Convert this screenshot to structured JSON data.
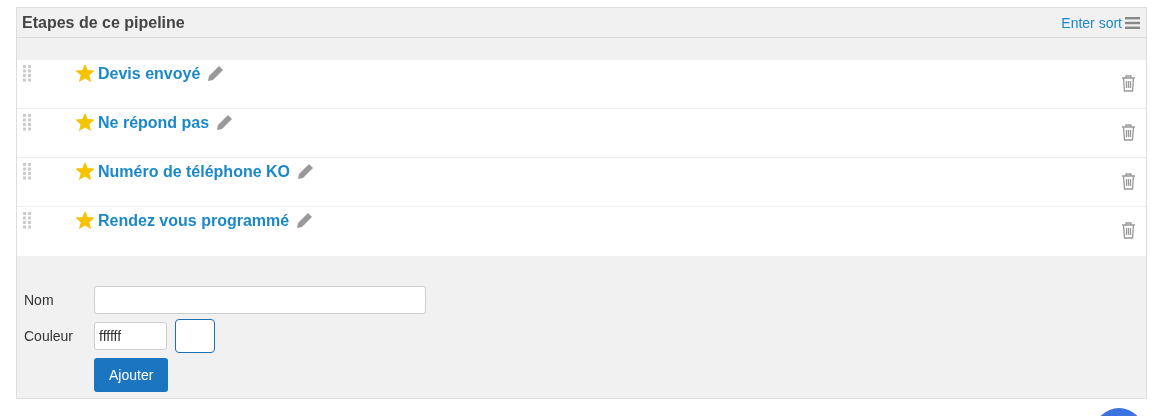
{
  "panel": {
    "title": "Etapes de ce pipeline",
    "sort_link": "Enter sort"
  },
  "stages": [
    {
      "name": "Devis envoyé",
      "starred": true
    },
    {
      "name": "Ne répond pas",
      "starred": true
    },
    {
      "name": "Numéro de téléphone KO",
      "starred": true
    },
    {
      "name": "Rendez vous programmé",
      "starred": true
    }
  ],
  "form": {
    "name_label": "Nom",
    "color_label": "Couleur",
    "color_value": "ffffff",
    "submit": "Ajouter"
  }
}
